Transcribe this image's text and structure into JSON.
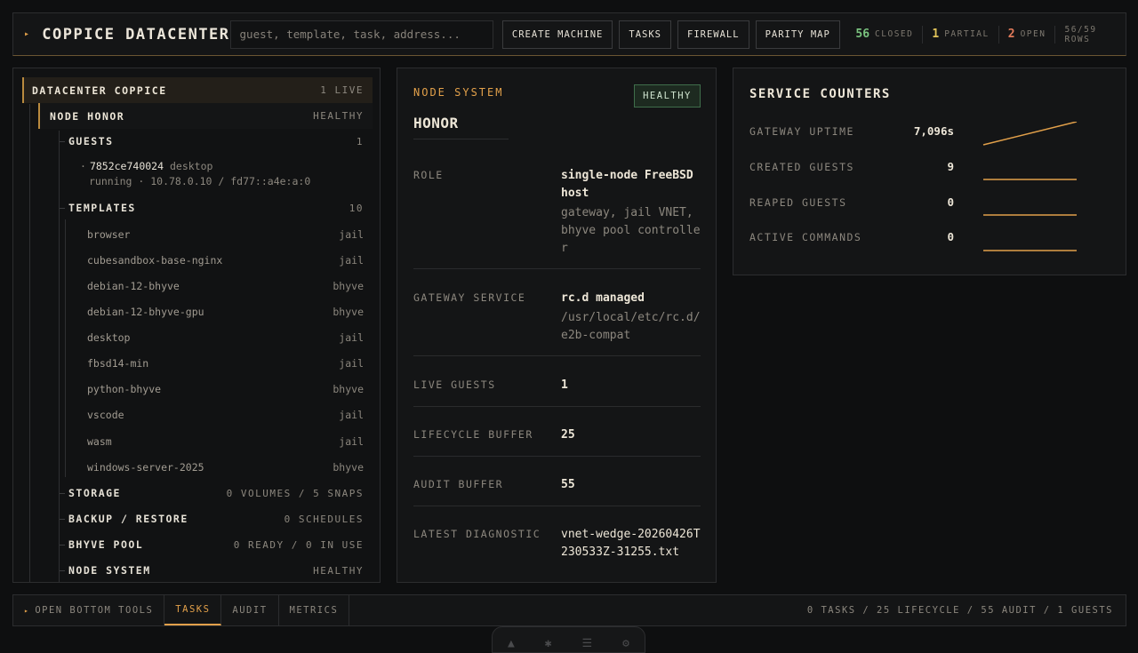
{
  "header": {
    "brand": "COPPICE DATACENTER",
    "search_placeholder": "guest, template, task, address...",
    "buttons": [
      "CREATE MACHINE",
      "TASKS",
      "FIREWALL",
      "PARITY MAP"
    ],
    "stats": [
      {
        "n": "56",
        "label": "CLOSED",
        "color": "#7ac37f"
      },
      {
        "n": "1",
        "label": "PARTIAL",
        "color": "#e0c35a"
      },
      {
        "n": "2",
        "label": "OPEN",
        "color": "#e07a5a"
      }
    ],
    "rows": "56/59 ROWS"
  },
  "tree": {
    "datacenter": {
      "label": "DATACENTER COPPICE",
      "value": "1 LIVE"
    },
    "node": {
      "label": "NODE HONOR",
      "value": "HEALTHY"
    },
    "guests": {
      "label": "GUESTS",
      "value": "1"
    },
    "guest": {
      "id": "7852ce740024",
      "kind": "desktop",
      "detail": "running · 10.78.0.10 / fd77::a4e:a:0"
    },
    "templates": {
      "label": "TEMPLATES",
      "value": "10"
    },
    "template_items": [
      {
        "name": "browser",
        "type": "jail"
      },
      {
        "name": "cubesandbox-base-nginx",
        "type": "jail"
      },
      {
        "name": "debian-12-bhyve",
        "type": "bhyve"
      },
      {
        "name": "debian-12-bhyve-gpu",
        "type": "bhyve"
      },
      {
        "name": "desktop",
        "type": "jail"
      },
      {
        "name": "fbsd14-min",
        "type": "jail"
      },
      {
        "name": "python-bhyve",
        "type": "bhyve"
      },
      {
        "name": "vscode",
        "type": "jail"
      },
      {
        "name": "wasm",
        "type": "jail"
      },
      {
        "name": "windows-server-2025",
        "type": "bhyve"
      }
    ],
    "storage": {
      "label": "STORAGE",
      "value": "0 VOLUMES / 5 SNAPS"
    },
    "backup": {
      "label": "BACKUP / RESTORE",
      "value": "0 SCHEDULES"
    },
    "bhyve_pool": {
      "label": "BHYVE POOL",
      "value": "0 READY / 0 IN USE"
    },
    "node_system": {
      "label": "NODE SYSTEM",
      "value": "HEALTHY"
    }
  },
  "detail": {
    "kicker": "NODE SYSTEM",
    "badge": "HEALTHY",
    "title": "HONOR",
    "role": {
      "key": "ROLE",
      "value": "single-node FreeBSD host",
      "sub": "gateway, jail VNET, bhyve pool controller"
    },
    "gateway": {
      "key": "GATEWAY SERVICE",
      "value": "rc.d managed",
      "sub": "/usr/local/etc/rc.d/e2b-compat"
    },
    "live_guests": {
      "key": "LIVE GUESTS",
      "value": "1"
    },
    "lifecycle": {
      "key": "LIFECYCLE BUFFER",
      "value": "25"
    },
    "audit": {
      "key": "AUDIT BUFFER",
      "value": "55"
    },
    "diagnostic": {
      "key": "LATEST DIAGNOSTIC",
      "value": "vnet-wedge-20260426T230533Z-31255.txt"
    }
  },
  "counters": {
    "title": "SERVICE COUNTERS",
    "accent": "#e2a04a",
    "items": [
      {
        "key": "GATEWAY UPTIME",
        "value": "7,096s",
        "trend": "rising"
      },
      {
        "key": "CREATED GUESTS",
        "value": "9",
        "trend": "flat"
      },
      {
        "key": "REAPED GUESTS",
        "value": "0",
        "trend": "flat"
      },
      {
        "key": "ACTIVE COMMANDS",
        "value": "0",
        "trend": "flat"
      }
    ]
  },
  "bottom": {
    "open_label": "OPEN BOTTOM TOOLS",
    "tabs": [
      "TASKS",
      "AUDIT",
      "METRICS"
    ],
    "active_tab": "TASKS",
    "summary": "0 TASKS / 25 LIFECYCLE / 55 AUDIT / 1 GUESTS"
  },
  "dock": {
    "icons": [
      "terminal-icon",
      "bug-icon",
      "menu-icon",
      "settings-icon"
    ]
  }
}
